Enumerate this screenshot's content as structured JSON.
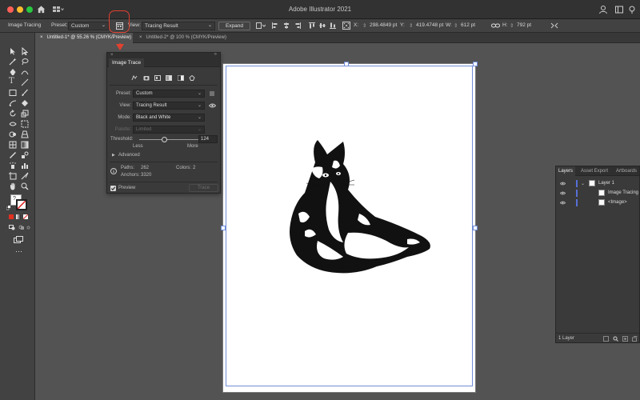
{
  "window": {
    "title": "Adobe Illustrator 2021"
  },
  "control_bar": {
    "mode_label": "Image Tracing",
    "preset_label": "Preset:",
    "preset_value": "Custom",
    "view_label": "View:",
    "view_value": "Tracing Result",
    "expand_label": "Expand",
    "x_label": "X:",
    "x_value": "298.4849 pt",
    "y_label": "Y:",
    "y_value": "419.4748 pt",
    "w_label": "W:",
    "w_value": "612 pt",
    "h_label": "H:",
    "h_value": "792 pt"
  },
  "tabs": [
    {
      "label": "Untitled-1* @ 55.26 % (CMYK/Preview)",
      "active": true
    },
    {
      "label": "Untitled-2* @ 100 % (CMYK/Preview)",
      "active": false
    }
  ],
  "image_trace": {
    "title": "Image Trace",
    "preset_label": "Preset:",
    "preset_value": "Custom",
    "view_label": "View:",
    "view_value": "Tracing Result",
    "mode_label": "Mode:",
    "mode_value": "Black and White",
    "palette_label": "Palette:",
    "palette_value": "Limited",
    "threshold_label": "Threshold:",
    "threshold_value": "124",
    "less_label": "Less",
    "more_label": "More",
    "advanced_label": "Advanced",
    "paths_label": "Paths:",
    "paths_value": "262",
    "colors_label": "Colors:",
    "colors_value": "2",
    "anchors_label": "Anchors:",
    "anchors_value": "3320",
    "preview_label": "Preview",
    "trace_label": "Trace"
  },
  "layers_panel": {
    "tabs": [
      "Layers",
      "Asset Export",
      "Artboards"
    ],
    "rows": [
      {
        "label": "Layer 1"
      },
      {
        "label": "Image Tracing"
      },
      {
        "label": "<Image>"
      }
    ],
    "footer": "1 Layer"
  }
}
